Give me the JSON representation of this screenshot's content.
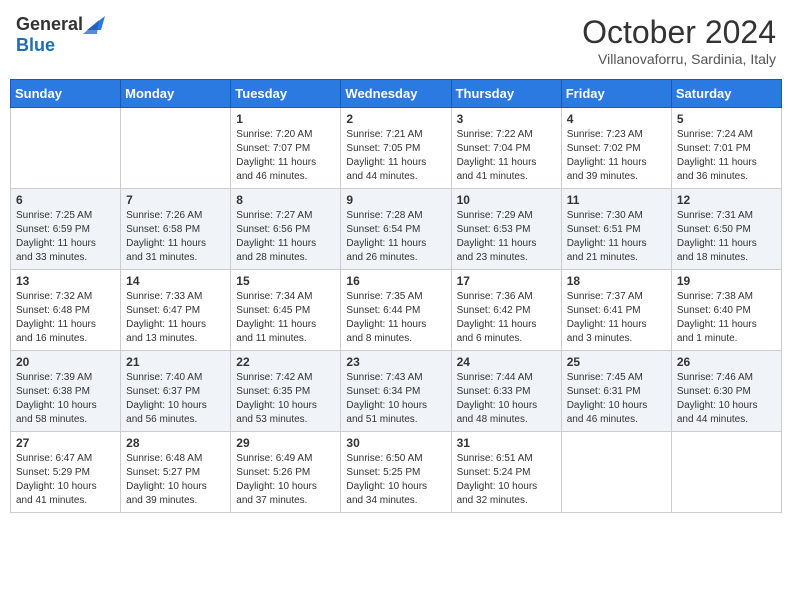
{
  "header": {
    "logo_general": "General",
    "logo_blue": "Blue",
    "month": "October 2024",
    "location": "Villanovaforru, Sardinia, Italy"
  },
  "days_of_week": [
    "Sunday",
    "Monday",
    "Tuesday",
    "Wednesday",
    "Thursday",
    "Friday",
    "Saturday"
  ],
  "weeks": [
    [
      {
        "day": "",
        "info": ""
      },
      {
        "day": "",
        "info": ""
      },
      {
        "day": "1",
        "info": "Sunrise: 7:20 AM\nSunset: 7:07 PM\nDaylight: 11 hours and 46 minutes."
      },
      {
        "day": "2",
        "info": "Sunrise: 7:21 AM\nSunset: 7:05 PM\nDaylight: 11 hours and 44 minutes."
      },
      {
        "day": "3",
        "info": "Sunrise: 7:22 AM\nSunset: 7:04 PM\nDaylight: 11 hours and 41 minutes."
      },
      {
        "day": "4",
        "info": "Sunrise: 7:23 AM\nSunset: 7:02 PM\nDaylight: 11 hours and 39 minutes."
      },
      {
        "day": "5",
        "info": "Sunrise: 7:24 AM\nSunset: 7:01 PM\nDaylight: 11 hours and 36 minutes."
      }
    ],
    [
      {
        "day": "6",
        "info": "Sunrise: 7:25 AM\nSunset: 6:59 PM\nDaylight: 11 hours and 33 minutes."
      },
      {
        "day": "7",
        "info": "Sunrise: 7:26 AM\nSunset: 6:58 PM\nDaylight: 11 hours and 31 minutes."
      },
      {
        "day": "8",
        "info": "Sunrise: 7:27 AM\nSunset: 6:56 PM\nDaylight: 11 hours and 28 minutes."
      },
      {
        "day": "9",
        "info": "Sunrise: 7:28 AM\nSunset: 6:54 PM\nDaylight: 11 hours and 26 minutes."
      },
      {
        "day": "10",
        "info": "Sunrise: 7:29 AM\nSunset: 6:53 PM\nDaylight: 11 hours and 23 minutes."
      },
      {
        "day": "11",
        "info": "Sunrise: 7:30 AM\nSunset: 6:51 PM\nDaylight: 11 hours and 21 minutes."
      },
      {
        "day": "12",
        "info": "Sunrise: 7:31 AM\nSunset: 6:50 PM\nDaylight: 11 hours and 18 minutes."
      }
    ],
    [
      {
        "day": "13",
        "info": "Sunrise: 7:32 AM\nSunset: 6:48 PM\nDaylight: 11 hours and 16 minutes."
      },
      {
        "day": "14",
        "info": "Sunrise: 7:33 AM\nSunset: 6:47 PM\nDaylight: 11 hours and 13 minutes."
      },
      {
        "day": "15",
        "info": "Sunrise: 7:34 AM\nSunset: 6:45 PM\nDaylight: 11 hours and 11 minutes."
      },
      {
        "day": "16",
        "info": "Sunrise: 7:35 AM\nSunset: 6:44 PM\nDaylight: 11 hours and 8 minutes."
      },
      {
        "day": "17",
        "info": "Sunrise: 7:36 AM\nSunset: 6:42 PM\nDaylight: 11 hours and 6 minutes."
      },
      {
        "day": "18",
        "info": "Sunrise: 7:37 AM\nSunset: 6:41 PM\nDaylight: 11 hours and 3 minutes."
      },
      {
        "day": "19",
        "info": "Sunrise: 7:38 AM\nSunset: 6:40 PM\nDaylight: 11 hours and 1 minute."
      }
    ],
    [
      {
        "day": "20",
        "info": "Sunrise: 7:39 AM\nSunset: 6:38 PM\nDaylight: 10 hours and 58 minutes."
      },
      {
        "day": "21",
        "info": "Sunrise: 7:40 AM\nSunset: 6:37 PM\nDaylight: 10 hours and 56 minutes."
      },
      {
        "day": "22",
        "info": "Sunrise: 7:42 AM\nSunset: 6:35 PM\nDaylight: 10 hours and 53 minutes."
      },
      {
        "day": "23",
        "info": "Sunrise: 7:43 AM\nSunset: 6:34 PM\nDaylight: 10 hours and 51 minutes."
      },
      {
        "day": "24",
        "info": "Sunrise: 7:44 AM\nSunset: 6:33 PM\nDaylight: 10 hours and 48 minutes."
      },
      {
        "day": "25",
        "info": "Sunrise: 7:45 AM\nSunset: 6:31 PM\nDaylight: 10 hours and 46 minutes."
      },
      {
        "day": "26",
        "info": "Sunrise: 7:46 AM\nSunset: 6:30 PM\nDaylight: 10 hours and 44 minutes."
      }
    ],
    [
      {
        "day": "27",
        "info": "Sunrise: 6:47 AM\nSunset: 5:29 PM\nDaylight: 10 hours and 41 minutes."
      },
      {
        "day": "28",
        "info": "Sunrise: 6:48 AM\nSunset: 5:27 PM\nDaylight: 10 hours and 39 minutes."
      },
      {
        "day": "29",
        "info": "Sunrise: 6:49 AM\nSunset: 5:26 PM\nDaylight: 10 hours and 37 minutes."
      },
      {
        "day": "30",
        "info": "Sunrise: 6:50 AM\nSunset: 5:25 PM\nDaylight: 10 hours and 34 minutes."
      },
      {
        "day": "31",
        "info": "Sunrise: 6:51 AM\nSunset: 5:24 PM\nDaylight: 10 hours and 32 minutes."
      },
      {
        "day": "",
        "info": ""
      },
      {
        "day": "",
        "info": ""
      }
    ]
  ]
}
